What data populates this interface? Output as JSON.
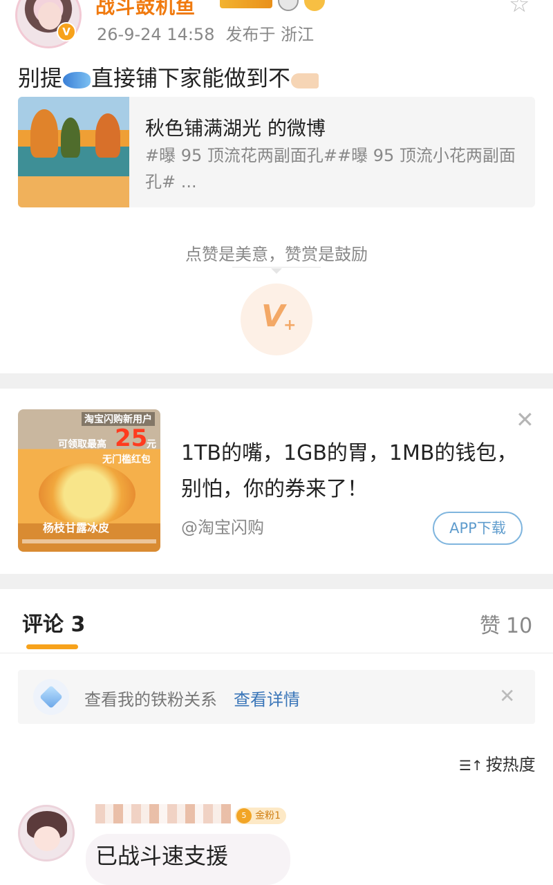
{
  "post": {
    "username": "战斗鼓机鱼",
    "verified_badge": "V",
    "timestamp": "26-9-24 14:58",
    "location": "发布于 浙江",
    "text_part1": "别提",
    "text_part2": "直接铺下家能做到不",
    "icons": [
      "fish-emoji",
      "pointing-hand-emoji",
      "star-icon"
    ]
  },
  "repost": {
    "title": "秋色铺满湖光 的微博",
    "desc": "#曝 95 顶流花两副面孔##曝 95 顶流小花两副面孔# ..."
  },
  "reward": {
    "text": "点赞是美意，赞赏是鼓励",
    "icon": "V+"
  },
  "ad": {
    "image_text": {
      "line1": "淘宝闪购新用户",
      "line2": "可领取最高",
      "amount": "25",
      "unit": "元",
      "line3": "无门槛红包",
      "line4": "杨枝甘露冰皮"
    },
    "text": "1TB的嘴，1GB的胃，1MB的钱包，别怕，你的券来了！",
    "source": "@淘宝闪购",
    "button": "APP下载"
  },
  "comments_header": {
    "tab_label": "评论 3",
    "likes_label": "赞",
    "likes_count": "10"
  },
  "fan_banner": {
    "text": "查看我的铁粉关系",
    "link": "查看详情"
  },
  "sort": {
    "label": "按热度"
  },
  "comment": {
    "fan_tag": "金粉1",
    "fan_level": "5",
    "text": "已战斗速支援"
  },
  "colors": {
    "accent_orange": "#f07a0f",
    "underline": "#f7a21b",
    "link_blue": "#3975b8",
    "button_blue": "#5f9ccd"
  }
}
